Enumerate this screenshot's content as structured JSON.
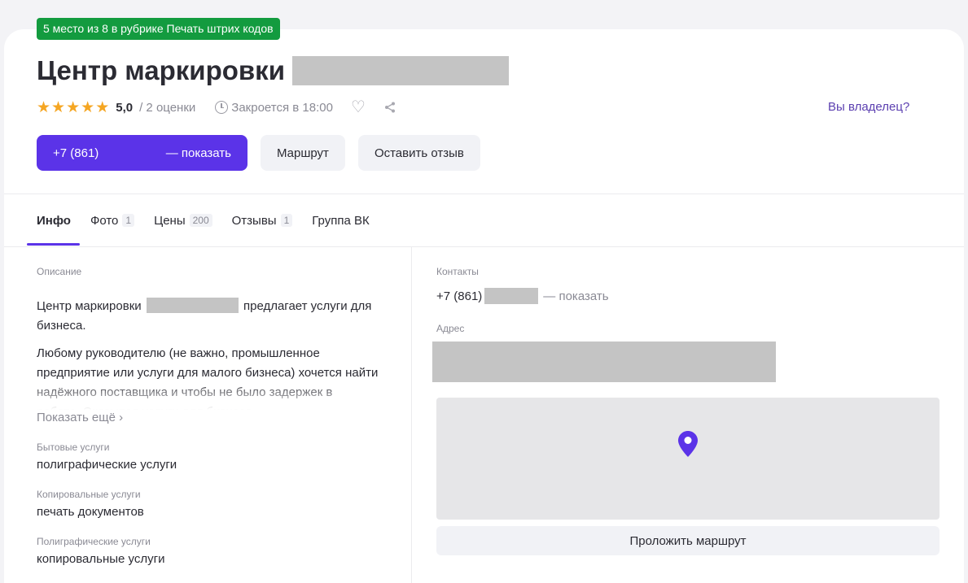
{
  "header": {
    "rank_badge": "5 место из 8 в рубрике Печать штрих кодов",
    "title": "Центр маркировки",
    "stars": 5,
    "rating": "5,0",
    "reviews_count": "/ 2 оценки",
    "closes": "Закроется в 18:00",
    "owner_link": "Вы владелец?"
  },
  "actions": {
    "phone_prefix": "+7 (861)",
    "phone_show": "— показать",
    "route": "Маршрут",
    "review": "Оставить отзыв"
  },
  "tabs": [
    {
      "label": "Инфо",
      "count": ""
    },
    {
      "label": "Фото",
      "count": "1"
    },
    {
      "label": "Цены",
      "count": "200"
    },
    {
      "label": "Отзывы",
      "count": "1"
    },
    {
      "label": "Группа ВК",
      "count": ""
    }
  ],
  "info": {
    "description_label": "Описание",
    "description_p1_start": "Центр маркировки",
    "description_p1_end": "предлагает услуги для бизнеса.",
    "description_p2": "Любому руководителю (не важно, промышленное предприятие или услуги для малого бизнеса) хочется найти надёжного поставщика и чтобы не было задержек в работе. Оказывая услуги для бизнеса",
    "show_more": "Показать ещё ›",
    "categories": [
      {
        "label": "Бытовые услуги",
        "value": "полиграфические услуги"
      },
      {
        "label": "Копировальные услуги",
        "value": "печать документов"
      },
      {
        "label": "Полиграфические услуги",
        "value": "копировальные услуги"
      }
    ]
  },
  "contacts": {
    "label": "Контакты",
    "phone_prefix": "+7 (861)",
    "phone_show": "— показать",
    "address_label": "Адрес",
    "route_button": "Проложить маршрут"
  },
  "colors": {
    "accent": "#5b33e8",
    "badge_green": "#139b3f",
    "star": "#f5a623",
    "owner_link": "#5b3fb0"
  },
  "icons": {
    "star": "star-icon",
    "clock": "clock-icon",
    "heart": "heart-icon",
    "share": "share-icon",
    "pin": "map-pin-icon"
  }
}
